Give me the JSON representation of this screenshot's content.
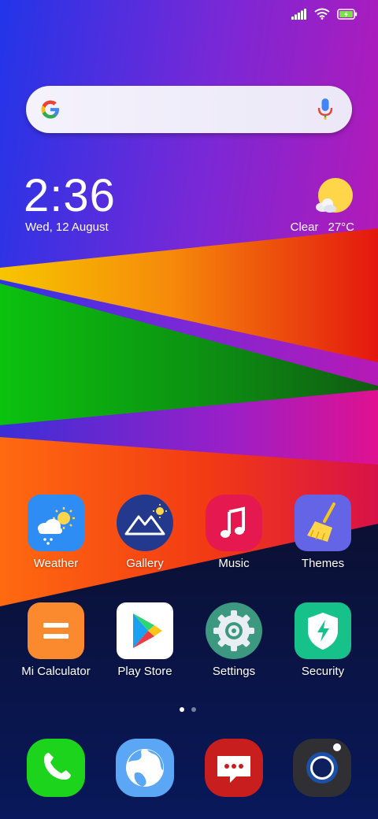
{
  "status_bar": {
    "signal_icon": "cellular-signal-icon",
    "wifi_icon": "wifi-icon",
    "battery_icon": "battery-charging-icon"
  },
  "search": {
    "logo_icon": "google-g-icon",
    "mic_icon": "microphone-icon"
  },
  "clock_widget": {
    "time": "2:36",
    "date": "Wed, 12 August",
    "weather_condition": "Clear",
    "temperature": "27°C",
    "weather_icon": "sun-cloud-icon"
  },
  "apps": [
    {
      "label": "Weather",
      "icon": "weather-app-icon",
      "color": "#2d8df5"
    },
    {
      "label": "Gallery",
      "icon": "gallery-app-icon",
      "color": "#23398d"
    },
    {
      "label": "Music",
      "icon": "music-app-icon",
      "color": "#e5194f"
    },
    {
      "label": "Themes",
      "icon": "themes-app-icon",
      "color": "#6364e6"
    },
    {
      "label": "Mi Calculator",
      "icon": "calculator-app-icon",
      "color": "#fb8a2e"
    },
    {
      "label": "Play Store",
      "icon": "play-store-icon",
      "color": "#ffffff"
    },
    {
      "label": "Settings",
      "icon": "settings-gear-icon",
      "color": "#3c9980"
    },
    {
      "label": "Security",
      "icon": "security-shield-icon",
      "color": "#17c28a"
    }
  ],
  "page_indicator": {
    "pages": 2,
    "current": 1
  },
  "dock": [
    {
      "icon": "phone-icon",
      "color": "#1dd41d"
    },
    {
      "icon": "browser-globe-icon",
      "color": "#5ba6f5"
    },
    {
      "icon": "messages-icon",
      "color": "#c81e1e"
    },
    {
      "icon": "camera-icon",
      "color": "#2f2f34"
    }
  ]
}
